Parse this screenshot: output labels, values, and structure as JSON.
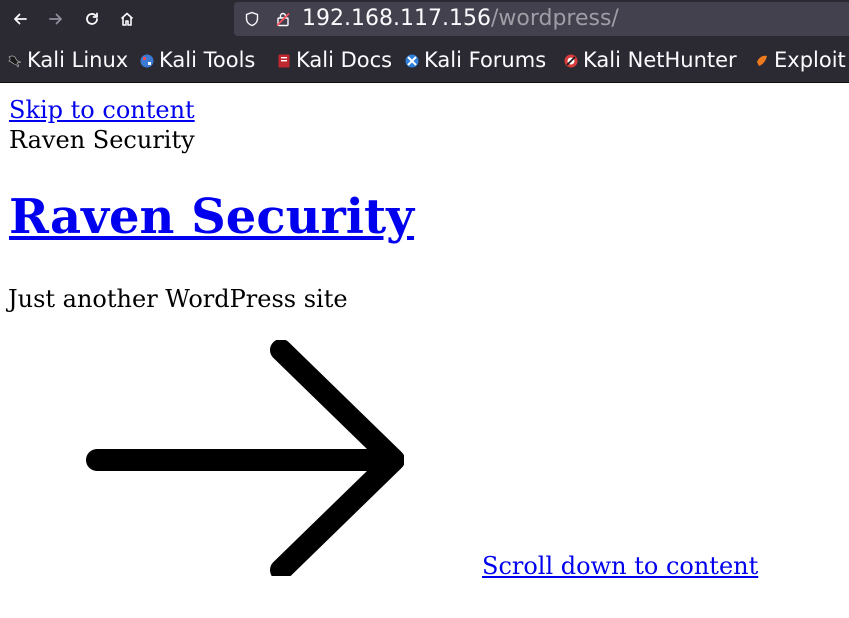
{
  "browser": {
    "url_host": "192.168.117.156",
    "url_path": "/wordpress/",
    "nav_icons": [
      "back-icon",
      "forward-icon",
      "reload-icon",
      "home-icon"
    ],
    "bookmarks": [
      {
        "label": "Kali Linux",
        "icon": "kali-dragon-icon"
      },
      {
        "label": "Kali Tools",
        "icon": "kali-tools-icon"
      },
      {
        "label": "Kali Docs",
        "icon": "kali-docs-icon"
      },
      {
        "label": "Kali Forums",
        "icon": "kali-forums-icon"
      },
      {
        "label": "Kali NetHunter",
        "icon": "kali-nethunter-icon"
      },
      {
        "label": "Exploit",
        "icon": "exploit-db-icon"
      }
    ]
  },
  "page": {
    "skip_link": "Skip to content",
    "site_name": "Raven Security",
    "site_title": "Raven Security",
    "tagline": "Just another WordPress site",
    "scroll_icon": "arrow-right-icon",
    "scroll_link": "Scroll down to content"
  },
  "colors": {
    "chrome_bg": "#2b2a33",
    "urlbar_bg": "#42414d",
    "link": "#0000ee",
    "text": "#000000"
  }
}
